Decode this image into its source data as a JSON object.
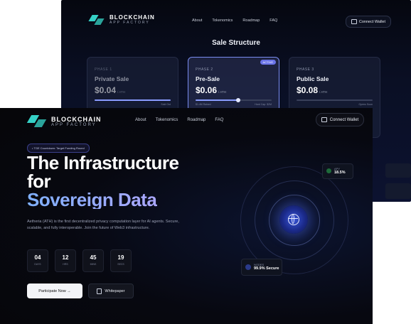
{
  "back_window": {
    "brand": {
      "line1": "BLOCKCHAIN",
      "line2": "APP FACTORY"
    },
    "nav": [
      "About",
      "Tokenomics",
      "Roadmap",
      "FAQ"
    ],
    "connect_wallet": "Connect Wallet",
    "section_title": "Sale Structure",
    "phases": [
      {
        "phase": "PHASE 1",
        "name": "Private Sale",
        "price": "$0.04",
        "unit": "/ ATH",
        "badge": "",
        "progress": 1.0,
        "left_note": "",
        "right_note": "Sold Out"
      },
      {
        "phase": "PHASE 2",
        "name": "Pre-Sale",
        "price": "$0.06",
        "unit": "/ ATH",
        "badge": "ACTIVE",
        "progress": 0.55,
        "left_note": "$1.4M Raised",
        "right_note": "Hard Cap: $2M"
      },
      {
        "phase": "PHASE 3",
        "name": "Public Sale",
        "price": "$0.08",
        "unit": "/ ATH",
        "badge": "",
        "progress": 0.0,
        "left_note": "",
        "right_note": "Opens Soon"
      }
    ]
  },
  "front_window": {
    "brand": {
      "line1": "BLOCKCHAIN",
      "line2": "APP FACTORY"
    },
    "nav": [
      "About",
      "Tokenomics",
      "Roadmap",
      "FAQ"
    ],
    "connect_wallet": "Connect Wallet",
    "tag": "• TGE Countdown: Target Funding Round",
    "headline": {
      "line1": "The Infrastructure",
      "line2": "for",
      "line3": "Sovereign Data"
    },
    "description": "Aetheria (ATH) is the first decentralized privacy computation layer for AI agents. Secure, scalable, and fully interoperable. Join the future of Web3 infrastructure.",
    "countdown": [
      {
        "value": "04",
        "unit": "DAYS"
      },
      {
        "value": "12",
        "unit": "HRS"
      },
      {
        "value": "45",
        "unit": "MINS"
      },
      {
        "value": "19",
        "unit": "SECS"
      }
    ],
    "cta_primary": "Participate Now →",
    "cta_secondary": "Whitepaper",
    "stat_apy": {
      "label": "APY",
      "value": "18.5%"
    },
    "stat_nodes": {
      "label": "NODES",
      "value": "99.9% Secure"
    }
  }
}
